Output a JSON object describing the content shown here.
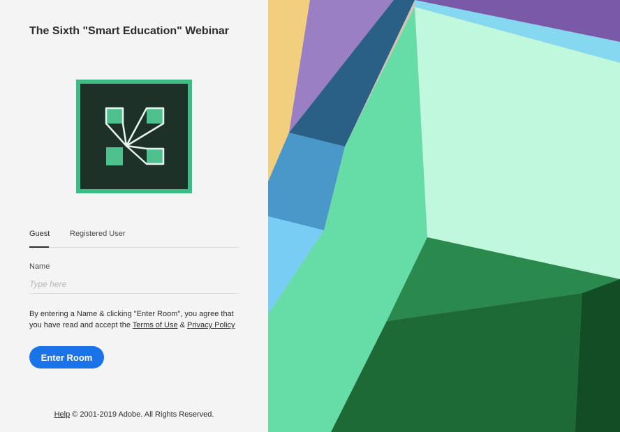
{
  "page": {
    "title": "The Sixth \"Smart Education\" Webinar"
  },
  "logo": {
    "icon": "adobe-connect-logo-icon",
    "accent": "#3dbb85"
  },
  "tabs": [
    {
      "label": "Guest",
      "active": true
    },
    {
      "label": "Registered User",
      "active": false
    }
  ],
  "form": {
    "name_label": "Name",
    "name_placeholder": "Type here",
    "name_value": ""
  },
  "agreement": {
    "text_before": "By entering a Name & clicking \"Enter Room\", you agree that you have read and accept the ",
    "terms_link": "Terms of Use",
    "and": " & ",
    "privacy_link": "Privacy Policy"
  },
  "enter_button": {
    "label": "Enter Room",
    "color": "#1a73e8"
  },
  "footer": {
    "help_link": "Help",
    "copyright": " © 2001-2019 Adobe. All Rights Reserved."
  }
}
